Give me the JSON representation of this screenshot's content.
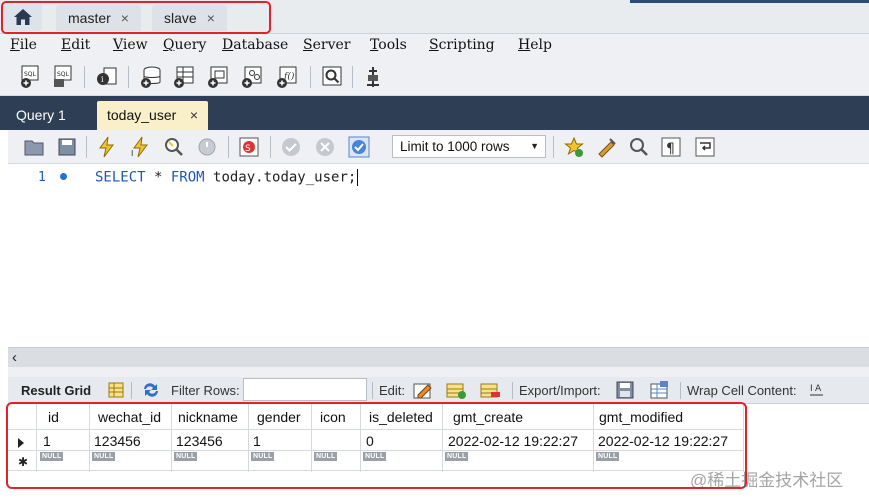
{
  "connection_tabs": {
    "home_icon": "home-icon",
    "tabs": [
      {
        "label": "master",
        "close": "×"
      },
      {
        "label": "slave",
        "close": "×"
      }
    ]
  },
  "menu": {
    "items": [
      {
        "accel": "F",
        "rest": "ile"
      },
      {
        "accel": "E",
        "rest": "dit"
      },
      {
        "accel": "V",
        "rest": "iew"
      },
      {
        "accel": "Q",
        "rest": "uery"
      },
      {
        "accel": "D",
        "rest": "atabase"
      },
      {
        "accel": "S",
        "rest": "erver"
      },
      {
        "accel": "T",
        "rest": "ools"
      },
      {
        "accel": "S",
        "rest": "cripting"
      },
      {
        "accel": "H",
        "rest": "elp"
      }
    ]
  },
  "query_tabs": {
    "tab1": "Query 1",
    "tab2": "today_user",
    "tab2_close": "×"
  },
  "editor_toolbar": {
    "limit_rows": "Limit to 1000 rows"
  },
  "editor": {
    "line_number": "1",
    "sql_keywords": [
      "SELECT",
      "FROM"
    ],
    "sql_parts": {
      "select": "SELECT",
      "star": " * ",
      "from": "FROM",
      "target": " today.today_user;"
    }
  },
  "result_toolbar": {
    "result_grid": "Result Grid",
    "filter_rows": "Filter Rows:",
    "edit": "Edit:",
    "export_import": "Export/Import:",
    "wrap_cell": "Wrap Cell Content:"
  },
  "grid": {
    "columns": [
      "id",
      "wechat_id",
      "nickname",
      "gender",
      "icon",
      "is_deleted",
      "gmt_create",
      "gmt_modified"
    ],
    "rows": [
      [
        "1",
        "123456",
        "123456",
        "1",
        "",
        "0",
        "2022-02-12 19:22:27",
        "2022-02-12 19:22:27"
      ]
    ],
    "null_label": "NULL"
  },
  "colors": {
    "highlight_red": "#e0232a",
    "tab_strip": "#2e3f55",
    "active_tab": "#f9efc9",
    "sql_keyword": "#1d58b6"
  },
  "watermark": "@稀土掘金技术社区"
}
